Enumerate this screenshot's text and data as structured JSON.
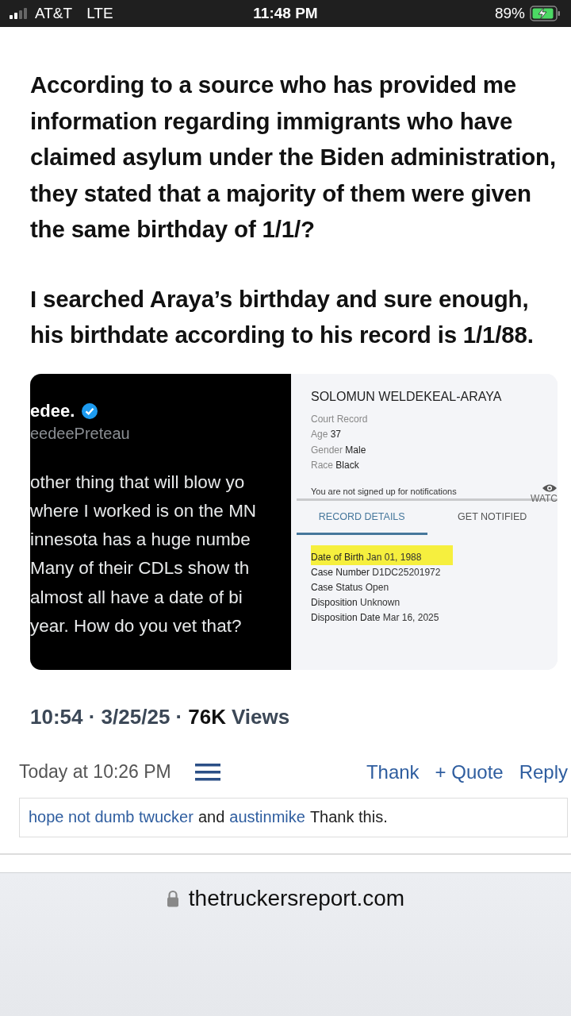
{
  "status_bar": {
    "carrier": "AT&T",
    "network": "LTE",
    "time": "11:48 PM",
    "battery": "89%",
    "charging": true
  },
  "post": {
    "paragraphs": [
      "According to a source who has provided me information regarding immigrants who have claimed asylum under the Biden administration, they stated that a majority of them were given the same birthday of 1/1/?",
      "I searched Araya’s birthday and sure enough, his birthdate according to his record is 1/1/88."
    ],
    "image": {
      "tweet": {
        "name": "edee.",
        "verified": true,
        "handle": "eedeePreteau",
        "lines": [
          "other thing that will blow yo",
          "where I worked is on the MN",
          "innesota has a huge numbe",
          "Many of their CDLs show th",
          "almost all have a date of bi",
          "year.  How do you vet that?"
        ]
      },
      "record": {
        "name": "SOLOMUN WELDEKEAL-ARAYA",
        "type": "Court Record",
        "facts": [
          {
            "label": "Age",
            "value": "37"
          },
          {
            "label": "Gender",
            "value": "Male"
          },
          {
            "label": "Race",
            "value": "Black"
          }
        ],
        "notice": "You are not signed up for notifications",
        "watch": "WATC",
        "tabs": [
          {
            "label": "RECORD DETAILS",
            "selected": true
          },
          {
            "label": "GET NOTIFIED",
            "selected": false
          }
        ],
        "details": [
          {
            "label": "Date of Birth",
            "value": "Jan 01, 1988",
            "highlighted": true
          },
          {
            "label": "Case Number",
            "value": "D1DC25201972",
            "highlighted": false
          },
          {
            "label": "Case Status",
            "value": "Open",
            "highlighted": false
          },
          {
            "label": "Disposition",
            "value": "Unknown",
            "highlighted": false
          },
          {
            "label": "Disposition Date",
            "value": "Mar 16, 2025",
            "highlighted": false
          }
        ]
      }
    },
    "tweet_meta": {
      "time_date": "10:54 · 3/25/25 ·",
      "views_count": "76K",
      "views_label": "Views"
    }
  },
  "post_meta": {
    "timestamp": "Today at 10:26 PM",
    "actions": [
      "Thank",
      "+ Quote",
      "Reply"
    ]
  },
  "likes": {
    "users": [
      "hope not dumb twucker",
      "austinmike"
    ],
    "joiner": "and",
    "suffix": "Thank this."
  },
  "address_bar": {
    "url": "thetruckersreport.com"
  }
}
